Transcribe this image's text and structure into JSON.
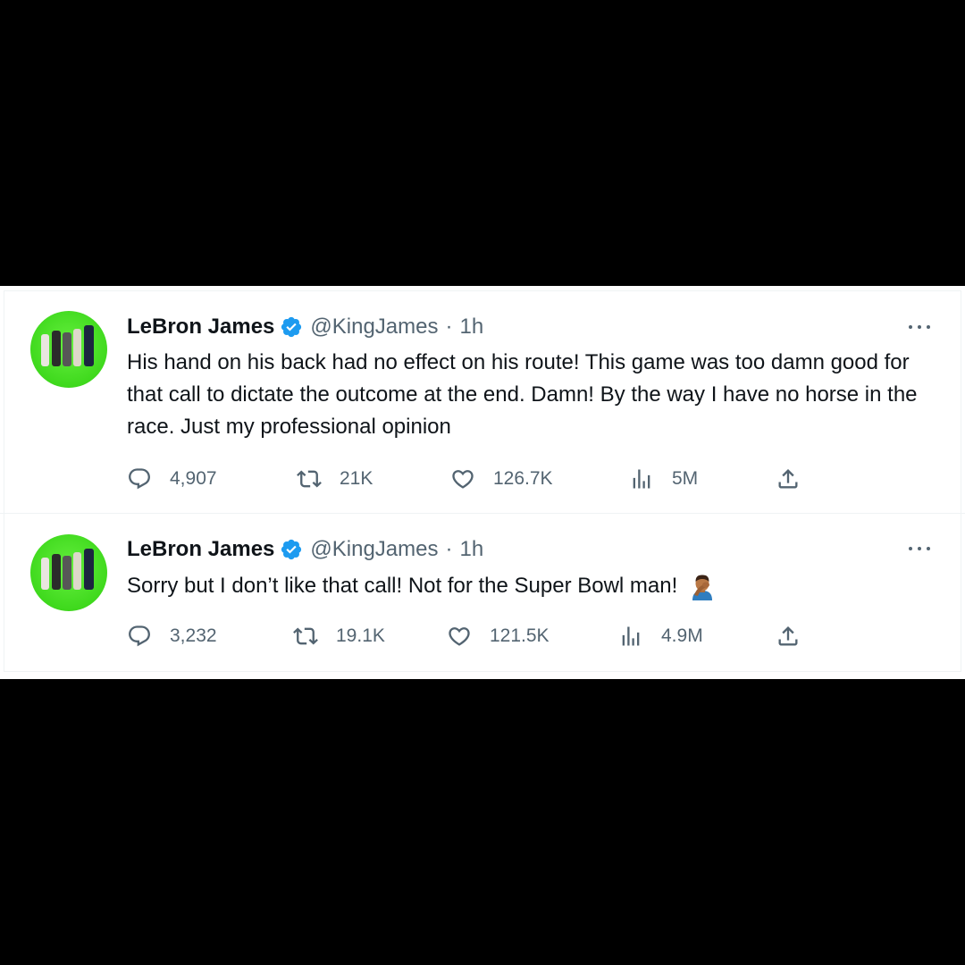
{
  "tweets": [
    {
      "name": "LeBron James",
      "handle": "@KingJames",
      "time": "1h",
      "separator": "·",
      "text": "His hand on his back had no effect on his route! This game was too damn good for that call to dictate the outcome at the end. Damn! By the way I have no horse in the race. Just my professional opinion",
      "replies": "4,907",
      "retweets": "21K",
      "likes": "126.7K",
      "views": "5M"
    },
    {
      "name": "LeBron James",
      "handle": "@KingJames",
      "time": "1h",
      "separator": "·",
      "text": "Sorry but I don’t like that call! Not for the Super Bowl man!",
      "emoji": "man-facepalming-emoji",
      "replies": "3,232",
      "retweets": "19.1K",
      "likes": "121.5K",
      "views": "4.9M"
    }
  ],
  "colors": {
    "verified": "#1d9bf0",
    "text": "#0f1419",
    "secondary": "#536471",
    "avatar_bg": "#3fd91d"
  }
}
